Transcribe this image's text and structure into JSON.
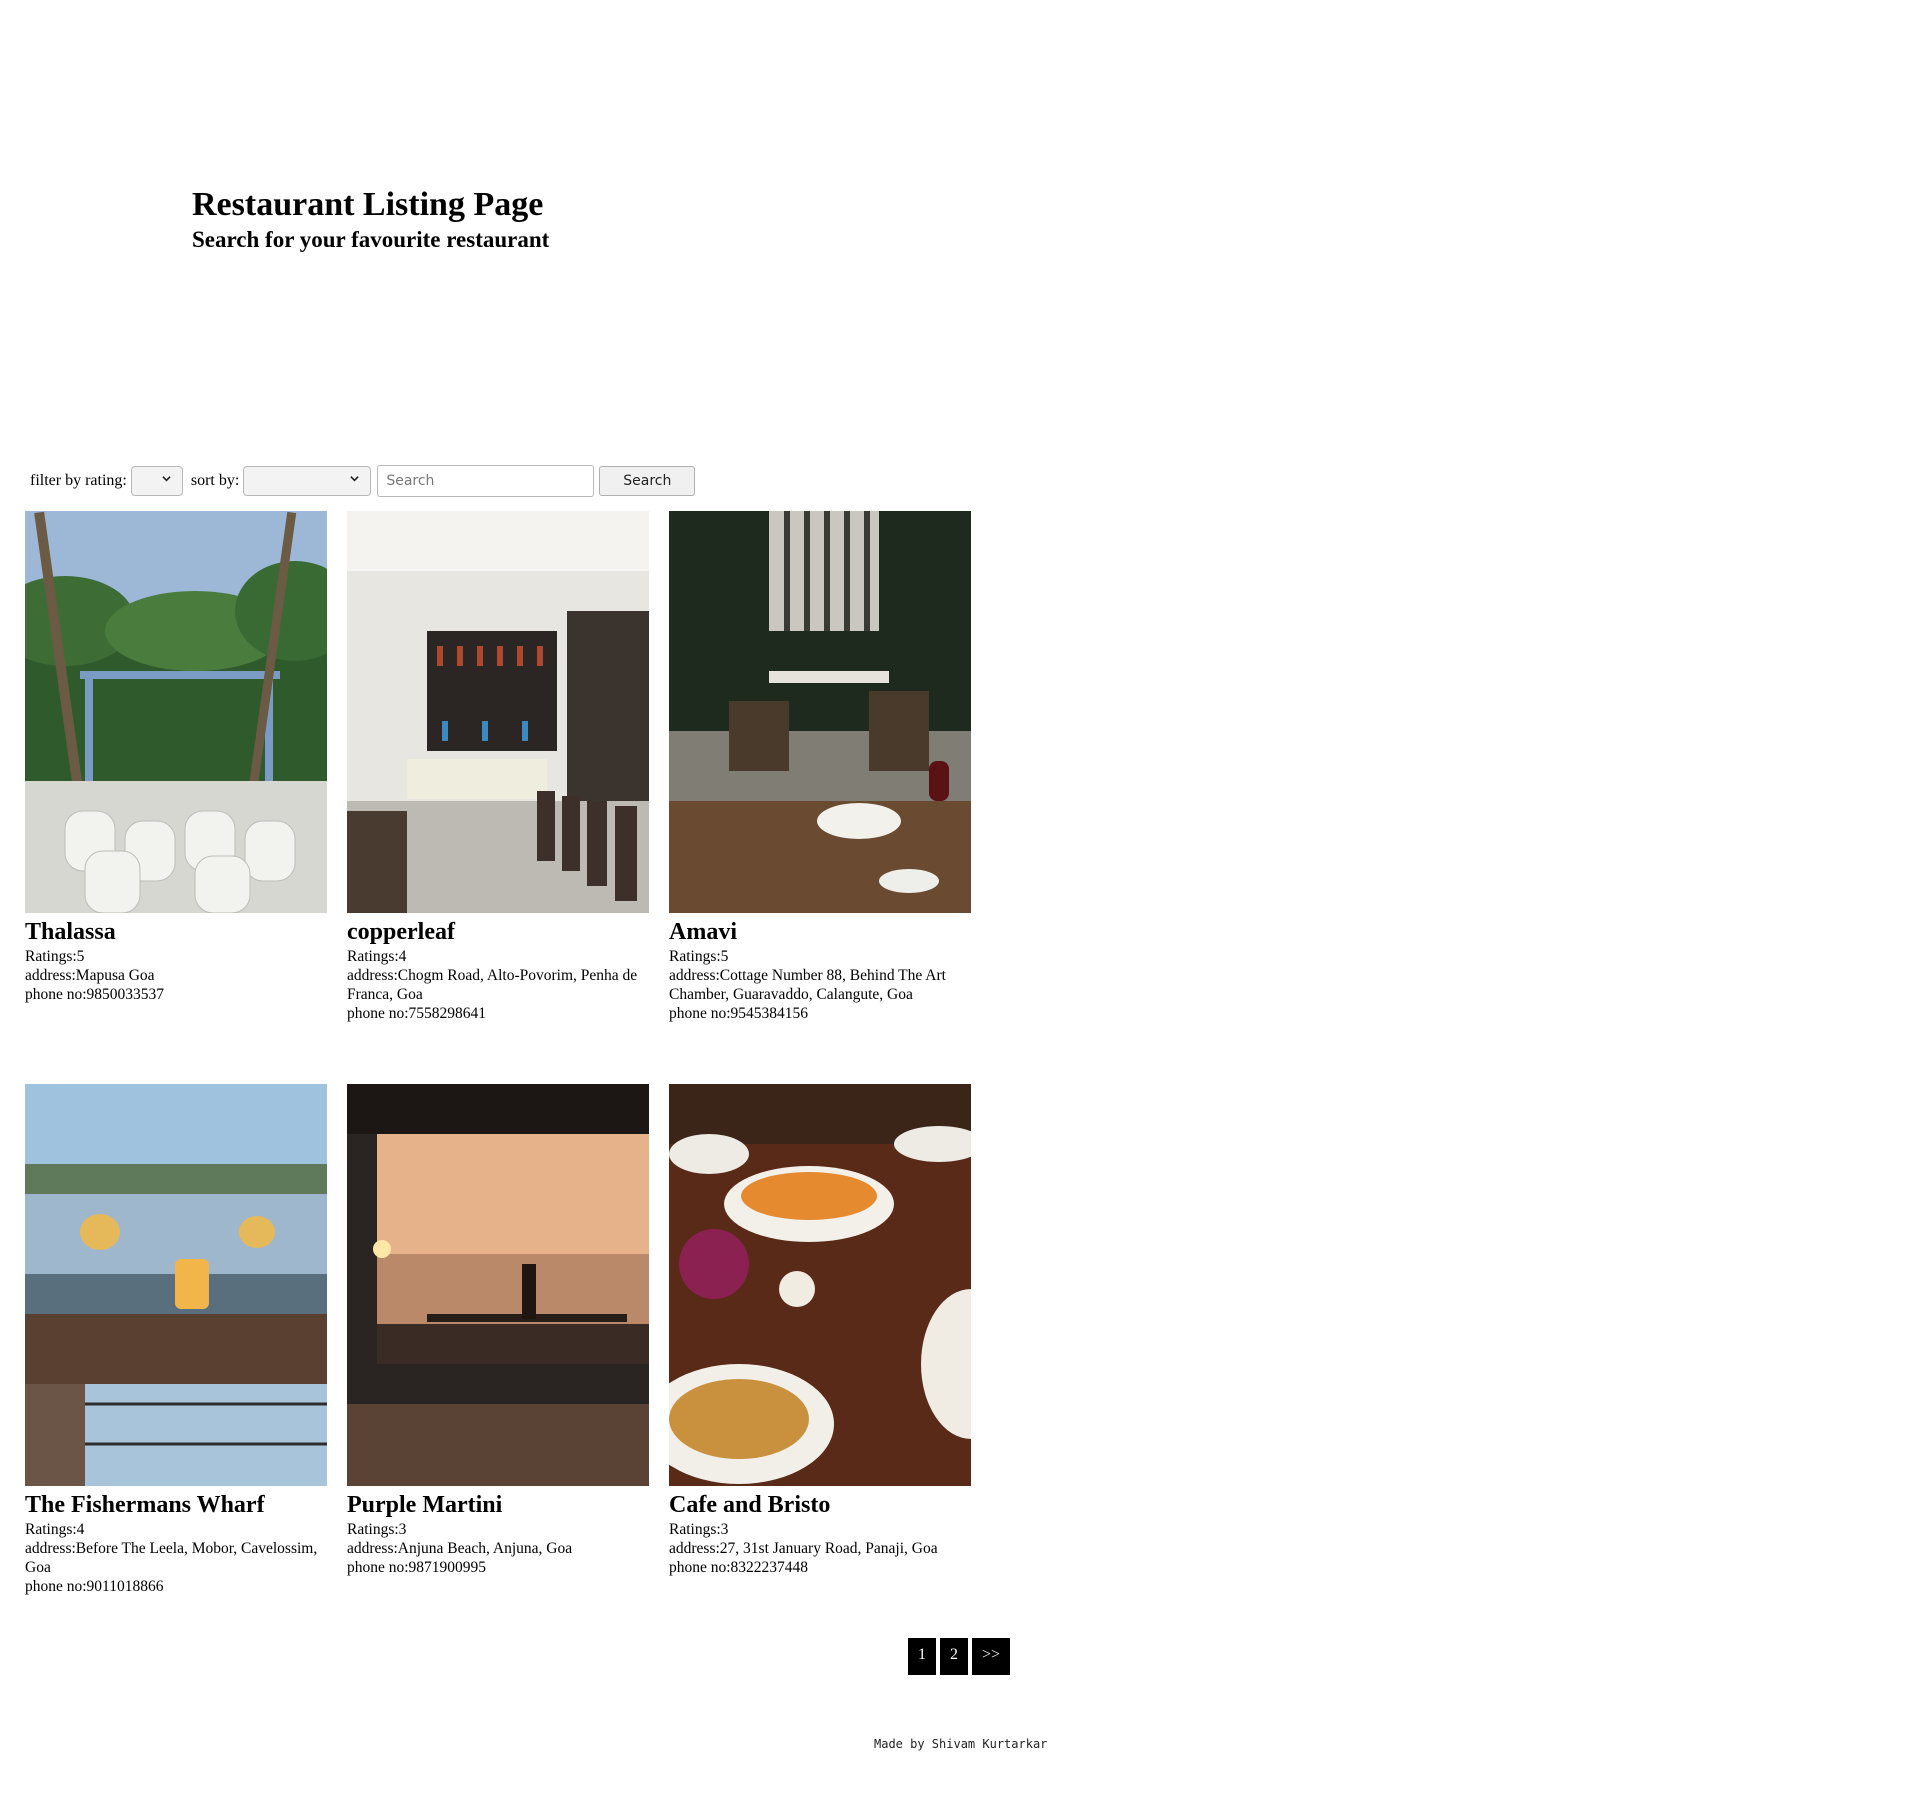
{
  "header": {
    "title": "Restaurant Listing Page",
    "subtitle": "Search for your favourite restaurant"
  },
  "controls": {
    "filter_label": "filter by rating:",
    "filter_value": "",
    "sort_label": "sort by:",
    "sort_value": "",
    "search_placeholder": "Search",
    "search_button": "Search"
  },
  "restaurants": [
    {
      "name": "Thalassa",
      "ratings": "Ratings:5",
      "address": "address:Mapusa Goa",
      "phone": "phone no:9850033537",
      "photo": "beach-venue-photo"
    },
    {
      "name": "copperleaf",
      "ratings": "Ratings:4",
      "address": "address:Chogm Road, Alto-Povorim, Penha de Franca, Goa",
      "phone": "phone no:7558298641",
      "photo": "bar-interior-photo"
    },
    {
      "name": "Amavi",
      "ratings": "Ratings:5",
      "address": "address:Cottage Number 88, Behind The Art Chamber, Guaravaddo, Calangute, Goa",
      "phone": "phone no:9545384156",
      "photo": "dining-terrace-photo"
    },
    {
      "name": "The Fishermans Wharf",
      "ratings": "Ratings:4",
      "address": "address:Before The Leela, Mobor, Cavelossim, Goa",
      "phone": "phone no:9011018866",
      "photo": "riverside-table-photo"
    },
    {
      "name": "Purple Martini",
      "ratings": "Ratings:3",
      "address": "address:Anjuna Beach, Anjuna, Goa",
      "phone": "phone no:9871900995",
      "photo": "sunset-bar-photo"
    },
    {
      "name": "Cafe and Bristo",
      "ratings": "Ratings:3",
      "address": "address:27, 31st January Road, Panaji, Goa",
      "phone": "phone no:8322237448",
      "photo": "food-table-photo"
    }
  ],
  "pagination": {
    "pages": [
      "1",
      "2"
    ],
    "next": ">>"
  },
  "footer": {
    "text": "Made by Shivam Kurtarkar"
  }
}
